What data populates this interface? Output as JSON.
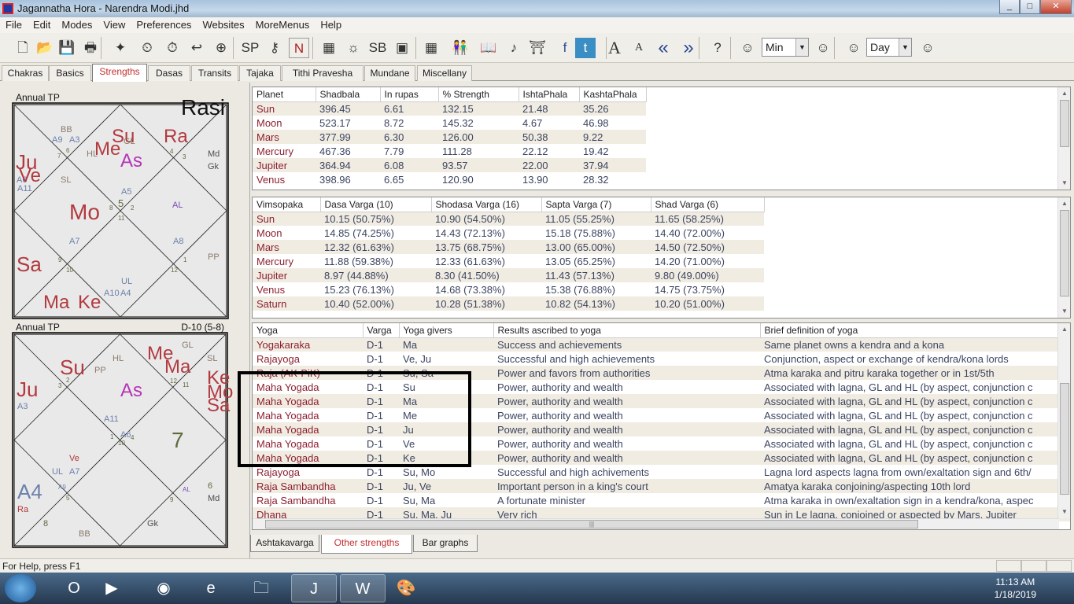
{
  "window": {
    "title": "Jagannatha Hora - Narendra Modi.jhd",
    "controls": [
      "_",
      "□",
      "✕"
    ]
  },
  "menu": [
    "File",
    "Edit",
    "Modes",
    "View",
    "Preferences",
    "Websites",
    "MoreMenus",
    "Help"
  ],
  "toolbar": {
    "icons": [
      {
        "name": "new-file-icon",
        "glyph": "🗋"
      },
      {
        "name": "open-folder-icon",
        "glyph": "📂"
      },
      {
        "name": "save-icon",
        "glyph": "💾"
      },
      {
        "name": "print-icon",
        "glyph": "🖶"
      },
      {
        "name": "chart-logo-icon",
        "glyph": "✦"
      },
      {
        "name": "data-clock-icon",
        "glyph": "⏲"
      },
      {
        "name": "time-back-icon",
        "glyph": "⏱"
      },
      {
        "name": "time-return-icon",
        "glyph": "↩"
      },
      {
        "name": "timezone-icon",
        "glyph": "⊕"
      },
      {
        "name": "sp-kh-icon",
        "glyph": "SP"
      },
      {
        "name": "key-k-icon",
        "glyph": "⚷"
      },
      {
        "name": "n-icon",
        "glyph": "N"
      },
      {
        "name": "grid-chart-icon",
        "glyph": "▦"
      },
      {
        "name": "sun-k-icon",
        "glyph": "☼"
      },
      {
        "name": "sb-icon",
        "glyph": "SB"
      },
      {
        "name": "k-square-icon",
        "glyph": "▣"
      },
      {
        "name": "b-grid-icon",
        "glyph": "▦"
      },
      {
        "name": "couple-icon",
        "glyph": "👫"
      },
      {
        "name": "book-icon",
        "glyph": "📖"
      },
      {
        "name": "dancer-icon",
        "glyph": "♪"
      },
      {
        "name": "temple-icon",
        "glyph": "⛩"
      },
      {
        "name": "facebook-icon",
        "glyph": "f"
      },
      {
        "name": "twitter-icon",
        "glyph": "t"
      },
      {
        "name": "font-larger-icon",
        "glyph": "A"
      },
      {
        "name": "font-smaller-icon",
        "glyph": "A"
      },
      {
        "name": "rewind-icon",
        "glyph": "«"
      },
      {
        "name": "forward-icon",
        "glyph": "»"
      },
      {
        "name": "help-icon",
        "glyph": "?"
      },
      {
        "name": "step-back-icon",
        "glyph": "☺"
      },
      {
        "name": "step-forward-icon",
        "glyph": "☺"
      },
      {
        "name": "step-back-2-icon",
        "glyph": "☺"
      },
      {
        "name": "step-forward-2-icon",
        "glyph": "☺"
      }
    ],
    "step_unit_1": "Min",
    "step_unit_2": "Day"
  },
  "tabs": [
    {
      "label": "Chakras"
    },
    {
      "label": "Basics"
    },
    {
      "label": "Strengths",
      "active": true
    },
    {
      "label": "Dasas"
    },
    {
      "label": "Transits"
    },
    {
      "label": "Tajaka"
    },
    {
      "label": "Tithi Pravesha"
    },
    {
      "label": "Mundane"
    },
    {
      "label": "Miscellany"
    }
  ],
  "charts": [
    {
      "caption": "Annual TP",
      "title": "Rasi",
      "labels": [
        {
          "text": "BB",
          "type": "sp"
        },
        {
          "text": "A9",
          "type": "ar"
        },
        {
          "text": "A3",
          "type": "ar"
        },
        {
          "text": "6",
          "type": "nu"
        },
        {
          "text": "7",
          "type": "nu"
        },
        {
          "text": "HL",
          "type": "sp"
        },
        {
          "text": "Me",
          "type": "pl"
        },
        {
          "text": "Su",
          "type": "pl"
        },
        {
          "text": "GL",
          "type": "sp"
        },
        {
          "text": "As",
          "type": "as"
        },
        {
          "text": "Ra",
          "type": "pl"
        },
        {
          "text": "4",
          "type": "nu"
        },
        {
          "text": "3",
          "type": "nu"
        },
        {
          "text": "Md",
          "type": "dk"
        },
        {
          "text": "Gk",
          "type": "dk"
        },
        {
          "text": "Ju",
          "type": "pl"
        },
        {
          "text": "A6",
          "type": "ar"
        },
        {
          "text": "Ve",
          "type": "pl"
        },
        {
          "text": "A11",
          "type": "ar"
        },
        {
          "text": "SL",
          "type": "sp"
        },
        {
          "text": "A5",
          "type": "ar"
        },
        {
          "text": "5",
          "type": "nu"
        },
        {
          "text": "8",
          "type": "nu"
        },
        {
          "text": "2",
          "type": "nu"
        },
        {
          "text": "11",
          "type": "nu"
        },
        {
          "text": "AL",
          "type": "al"
        },
        {
          "text": "Mo",
          "type": "pl"
        },
        {
          "text": "A7",
          "type": "ar"
        },
        {
          "text": "A8",
          "type": "ar"
        },
        {
          "text": "PP",
          "type": "sp"
        },
        {
          "text": "1",
          "type": "nu"
        },
        {
          "text": "12",
          "type": "nu"
        },
        {
          "text": "9",
          "type": "nu"
        },
        {
          "text": "10",
          "type": "nu"
        },
        {
          "text": "Sa",
          "type": "pl"
        },
        {
          "text": "UL",
          "type": "ar"
        },
        {
          "text": "A10",
          "type": "ar"
        },
        {
          "text": "A4",
          "type": "ar"
        },
        {
          "text": "Ma",
          "type": "pl"
        },
        {
          "text": "Ke",
          "type": "pl"
        }
      ]
    },
    {
      "caption": "Annual TP",
      "title": "D-10 (5-8)",
      "labels": [
        {
          "text": "GL",
          "type": "sp"
        },
        {
          "text": "HL",
          "type": "sp"
        },
        {
          "text": "PP",
          "type": "sp"
        },
        {
          "text": "SL",
          "type": "sp"
        },
        {
          "text": "Su",
          "type": "pl"
        },
        {
          "text": "2",
          "type": "nu"
        },
        {
          "text": "3",
          "type": "nu"
        },
        {
          "text": "Me",
          "type": "pl"
        },
        {
          "text": "Ma",
          "type": "pl"
        },
        {
          "text": "12",
          "type": "nu"
        },
        {
          "text": "11",
          "type": "nu"
        },
        {
          "text": "Ju",
          "type": "pl"
        },
        {
          "text": "A3",
          "type": "ar"
        },
        {
          "text": "As",
          "type": "as"
        },
        {
          "text": "Ke",
          "type": "pl"
        },
        {
          "text": "Mo",
          "type": "pl"
        },
        {
          "text": "Sa",
          "type": "pl"
        },
        {
          "text": "A11",
          "type": "ar"
        },
        {
          "text": "A6",
          "type": "ar"
        },
        {
          "text": "1",
          "type": "nu"
        },
        {
          "text": "4",
          "type": "nu"
        },
        {
          "text": "10",
          "type": "nu"
        },
        {
          "text": "7",
          "type": "nu"
        },
        {
          "text": "Ve",
          "type": "pl"
        },
        {
          "text": "UL",
          "type": "ar"
        },
        {
          "text": "A7",
          "type": "ar"
        },
        {
          "text": "A4",
          "type": "ar"
        },
        {
          "text": "Ra",
          "type": "pl"
        },
        {
          "text": "A9",
          "type": "ar"
        },
        {
          "text": "5",
          "type": "nu"
        },
        {
          "text": "6",
          "type": "nu"
        },
        {
          "text": "Md",
          "type": "dk"
        },
        {
          "text": "AL",
          "type": "al"
        },
        {
          "text": "9",
          "type": "nu"
        },
        {
          "text": "8",
          "type": "nu"
        },
        {
          "text": "Gk",
          "type": "dk"
        },
        {
          "text": "BB",
          "type": "sp"
        },
        {
          "text": "A10",
          "type": "ar"
        }
      ]
    }
  ],
  "shadbala": {
    "columns": [
      "Planet",
      "Shadbala",
      "In rupas",
      "% Strength",
      "IshtaPhala",
      "KashtaPhala"
    ],
    "rows": [
      [
        "Sun",
        "396.45",
        "6.61",
        "132.15",
        "21.48",
        "35.26"
      ],
      [
        "Moon",
        "523.17",
        "8.72",
        "145.32",
        "4.67",
        "46.98"
      ],
      [
        "Mars",
        "377.99",
        "6.30",
        "126.00",
        "50.38",
        "9.22"
      ],
      [
        "Mercury",
        "467.36",
        "7.79",
        "111.28",
        "22.12",
        "19.42"
      ],
      [
        "Jupiter",
        "364.94",
        "6.08",
        "93.57",
        "22.00",
        "37.94"
      ],
      [
        "Venus",
        "398.96",
        "6.65",
        "120.90",
        "13.90",
        "28.32"
      ]
    ]
  },
  "vimsopaka": {
    "columns": [
      "Vimsopaka",
      "Dasa Varga (10)",
      "Shodasa Varga (16)",
      "Sapta Varga (7)",
      "Shad Varga (6)"
    ],
    "rows": [
      [
        "Sun",
        "10.15  (50.75%)",
        "10.90  (54.50%)",
        "11.05  (55.25%)",
        "11.65  (58.25%)"
      ],
      [
        "Moon",
        "14.85  (74.25%)",
        "14.43  (72.13%)",
        "15.18  (75.88%)",
        "14.40  (72.00%)"
      ],
      [
        "Mars",
        "12.32  (61.63%)",
        "13.75  (68.75%)",
        "13.00  (65.00%)",
        "14.50  (72.50%)"
      ],
      [
        "Mercury",
        "11.88  (59.38%)",
        "12.33  (61.63%)",
        "13.05  (65.25%)",
        "14.20  (71.00%)"
      ],
      [
        "Jupiter",
        "8.97  (44.88%)",
        "8.30  (41.50%)",
        "11.43  (57.13%)",
        "9.80  (49.00%)"
      ],
      [
        "Venus",
        "15.23  (76.13%)",
        "14.68  (73.38%)",
        "15.38  (76.88%)",
        "14.75  (73.75%)"
      ],
      [
        "Saturn",
        "10.40  (52.00%)",
        "10.28  (51.38%)",
        "10.82  (54.13%)",
        "10.20  (51.00%)"
      ]
    ]
  },
  "yogas": {
    "columns": [
      "Yoga",
      "Varga",
      "Yoga givers",
      "Results ascribed to yoga",
      "Brief definition of yoga"
    ],
    "rows": [
      [
        "Yogakaraka",
        "D-1",
        "Ma",
        "Success and achievements",
        "Same planet owns a kendra and a kona"
      ],
      [
        "Rajayoga",
        "D-1",
        "Ve, Ju",
        "Successful and high achievements",
        "Conjunction, aspect or exchange of kendra/kona lords"
      ],
      [
        "Raja (AK-PiK)",
        "D-1",
        "Su, Sa",
        "Power and favors from authorities",
        "Atma karaka and pitru karaka together or in 1st/5th"
      ],
      [
        "Maha Yogada",
        "D-1",
        "Su",
        "Power, authority and wealth",
        "Associated with lagna, GL and HL (by aspect, conjunction c"
      ],
      [
        "Maha Yogada",
        "D-1",
        "Ma",
        "Power, authority and wealth",
        "Associated with lagna, GL and HL (by aspect, conjunction c"
      ],
      [
        "Maha Yogada",
        "D-1",
        "Me",
        "Power, authority and wealth",
        "Associated with lagna, GL and HL (by aspect, conjunction c"
      ],
      [
        "Maha Yogada",
        "D-1",
        "Ju",
        "Power, authority and wealth",
        "Associated with lagna, GL and HL (by aspect, conjunction c"
      ],
      [
        "Maha Yogada",
        "D-1",
        "Ve",
        "Power, authority and wealth",
        "Associated with lagna, GL and HL (by aspect, conjunction c"
      ],
      [
        "Maha Yogada",
        "D-1",
        "Ke",
        "Power, authority and wealth",
        "Associated with lagna, GL and HL (by aspect, conjunction c"
      ],
      [
        "Rajayoga",
        "D-1",
        "Su, Mo",
        "Successful and high achivements",
        "Lagna lord aspects lagna from own/exaltation sign and 6th/"
      ],
      [
        "Raja Sambandha",
        "D-1",
        "Ju, Ve",
        "Important person in a king's court",
        "Amatya karaka conjoining/aspecting 10th lord"
      ],
      [
        "Raja Sambandha",
        "D-1",
        "Su, Ma",
        "A fortunate minister",
        "Atma karaka in own/exaltation sign in a kendra/kona, aspec"
      ],
      [
        "Dhana",
        "D-1",
        "Su, Ma, Ju",
        "Very rich",
        "Sun in Le lagna, conjoined or aspected by Mars, Jupiter"
      ]
    ]
  },
  "bottom_tabs": [
    {
      "label": "Ashtakavarga"
    },
    {
      "label": "Other strengths",
      "active": true
    },
    {
      "label": "Bar graphs"
    }
  ],
  "status": {
    "help": "For Help, press F1"
  },
  "taskbar": {
    "apps": [
      {
        "name": "outlook-icon",
        "glyph": "O"
      },
      {
        "name": "media-player-icon",
        "glyph": "▶"
      },
      {
        "name": "chrome-icon",
        "glyph": "◉"
      },
      {
        "name": "ie-icon",
        "glyph": "e"
      },
      {
        "name": "explorer-icon",
        "glyph": "🗀"
      },
      {
        "name": "jhora-icon",
        "glyph": "J"
      },
      {
        "name": "word-icon",
        "glyph": "W"
      },
      {
        "name": "paint-icon",
        "glyph": "🎨"
      }
    ],
    "time": "11:13 AM",
    "date": "1/18/2019"
  }
}
